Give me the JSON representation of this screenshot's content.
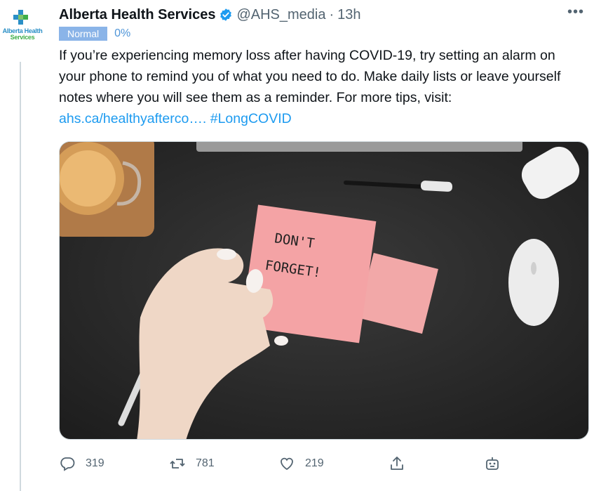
{
  "tweet": {
    "display_name": "Alberta Health Services",
    "handle": "@AHS_media",
    "separator": "·",
    "time": "13h",
    "more_label": "•••",
    "logo_text_line1": "Alberta Health",
    "logo_text_line2": "Services",
    "text_part1": "If you’re experiencing memory loss after having COVID-19, try setting an alarm on your phone to remind you of what you need to do. Make daily lists or leave yourself notes where you will see them as a reminder. For more tips, visit: ",
    "link": "ahs.ca/healthyafterco….",
    "hashtag": "#LongCOVID"
  },
  "label": {
    "badge": "Normal",
    "percent": "0%"
  },
  "media": {
    "note_line1": "DON'T",
    "note_line2": "FORGET!"
  },
  "actions": {
    "reply_count": "319",
    "retweet_count": "781",
    "like_count": "219"
  },
  "colors": {
    "link": "#1d9bf0",
    "badge": "#8ab4e8",
    "muted": "#536471"
  }
}
